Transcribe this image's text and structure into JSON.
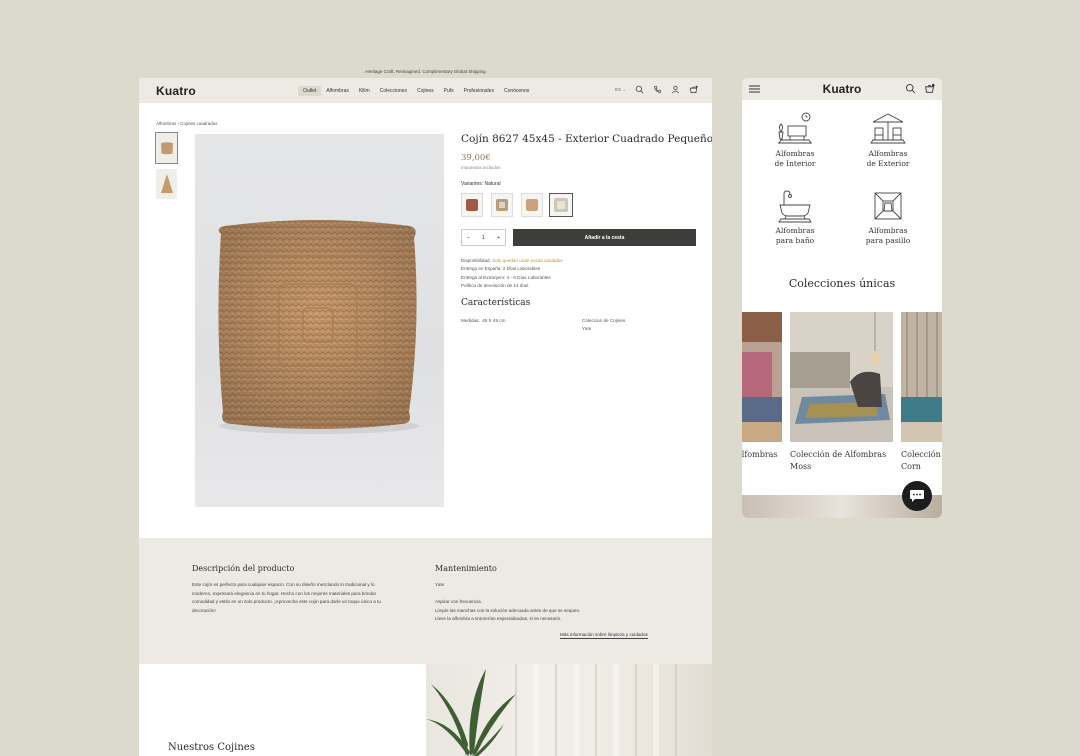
{
  "desktop": {
    "announcement": "Heritage Craft, Reimagined. Complimentary Global Shipping",
    "logo": "Kuatro",
    "nav": [
      "Outlet",
      "Alfombras",
      "Kilim",
      "Colecciones",
      "Cojines",
      "Pufs",
      "Profesionales",
      "Conócenos"
    ],
    "lang": "ES",
    "breadcrumb": "Alfombras  ›  Cojines cuadrados",
    "product": {
      "title": "Cojín 8627 45x45 - Exterior Cuadrado Pequeño",
      "price": "39,00€",
      "tax_note": "Impuestos incluidos",
      "variants_label": "Variantes: Natural",
      "quantity": "1",
      "add_to_cart": "Añadir a la cesta",
      "availability_label": "Disponibilidad:",
      "availability_value": "Solo quedan unas pocas unidades",
      "shipping_spain": "Entrega en España:   2 Días Laborables",
      "shipping_abroad": "Entrega al Extranjero:   4 - 6 Días Laborables",
      "returns": "Política de devolución de 14 días"
    },
    "features": {
      "title": "Características",
      "medidas_label": "Medidas:",
      "medidas_value": "45 X 45 cm",
      "collection": "Coleccion de Cojines",
      "material": "Yute"
    },
    "description": {
      "title": "Descripción del producto",
      "lines": [
        "Este cojín es perfecto para cualquier espacio. Con su diseño mezclando lo tradicional y lo",
        "moderno, expresará elegancia en tu hogar. Hecho con los mejores materiales para brindar",
        "comodidad y estilo en un solo producto. ¡Aprovecha este cojín para darle un toque único a tu",
        "decoración!"
      ]
    },
    "maintenance": {
      "title": "Mantenimiento",
      "material": "Yute",
      "lines": [
        "Aspirar con frecuencia.",
        "Limpie las manchas con la solución adecuada antes de que se sequen.",
        "Lleve la alfombra a tintorerías especializadas, si es necesario."
      ],
      "link": "Más información sobre limpieza y cuidados"
    },
    "bottom_title": "Nuestros Cojines"
  },
  "mobile": {
    "logo": "Kuatro",
    "categories": [
      {
        "line1": "Alfombras",
        "line2": "de Interior"
      },
      {
        "line1": "Alfombras",
        "line2": "de Exterior"
      },
      {
        "line1": "Alfombras",
        "line2": "para baño"
      },
      {
        "line1": "Alfombras",
        "line2": "para pasillo"
      }
    ],
    "section_title": "Colecciones únicas",
    "collections": [
      {
        "line1": "Alfombras",
        "line2": ""
      },
      {
        "line1": "Colección de Alfombras",
        "line2": "Moss"
      },
      {
        "line1": "Colección",
        "line2": "Corn"
      }
    ]
  },
  "colors": {
    "accent": "#3d3d39",
    "availability": "#c9921f",
    "price": "#8d7a64",
    "background": "#dcdacd",
    "band": "#eceae3"
  }
}
